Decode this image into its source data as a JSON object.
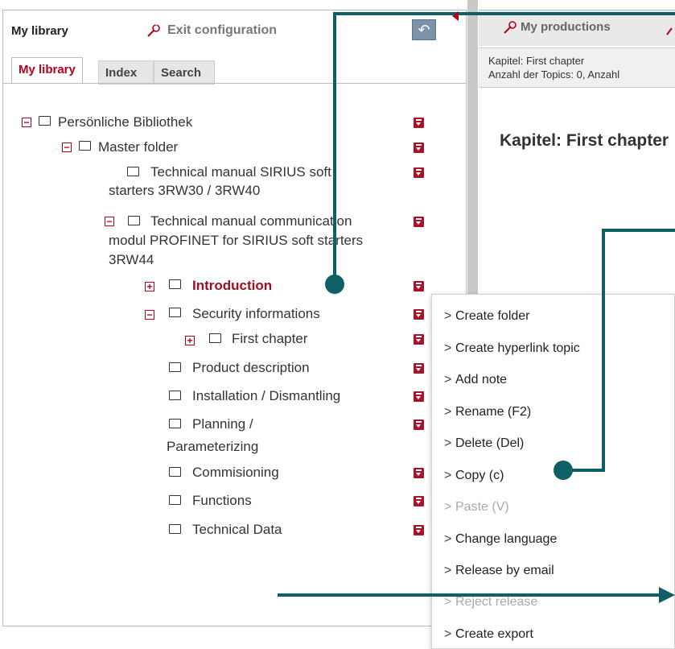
{
  "left_panel": {
    "title": "My library",
    "exit_config": "Exit configuration",
    "tabs": [
      {
        "label": "My library",
        "active": true
      },
      {
        "label": "Index",
        "active": false
      },
      {
        "label": "Search",
        "active": false
      }
    ],
    "tree": {
      "root": "Persönliche Bibliothek",
      "master": "Master folder",
      "manual1_line1": "Technical manual SIRIUS soft",
      "manual1_line2": "starters 3RW30 / 3RW40",
      "manual2_line1": "Technical manual communication",
      "manual2_line2": "modul PROFINET for SIRIUS soft starters",
      "manual2_line3": "3RW44",
      "introduction": "Introduction",
      "security": "Security informations",
      "first_chapter": "First chapter",
      "product_description": "Product description",
      "installation": "Installation / Dismantling",
      "planning_line1": "Planning /",
      "planning_line2": "Parameterizing",
      "commissioning": "Commisioning",
      "functions": "Functions",
      "technical_data": "Technical Data"
    }
  },
  "right_panel": {
    "tab_label": "My productions",
    "info_line1": "Kapitel: First chapter",
    "info_line2": "Anzahl der Topics: 0, Anzahl",
    "heading": "Kapitel: First chapter"
  },
  "context_menu": {
    "items": [
      {
        "label": "Create folder",
        "enabled": true
      },
      {
        "label": "Create hyperlink topic",
        "enabled": true
      },
      {
        "label": "Add note",
        "enabled": true
      },
      {
        "label": "Rename (F2)",
        "enabled": true
      },
      {
        "label": "Delete (Del)",
        "enabled": true
      },
      {
        "label": "Copy (c)",
        "enabled": true
      },
      {
        "label": "Paste (V)",
        "enabled": false
      },
      {
        "label": "Change language",
        "enabled": true
      },
      {
        "label": "Release by email",
        "enabled": true
      },
      {
        "label": "Reject release",
        "enabled": false
      },
      {
        "label": "Create export",
        "enabled": true
      }
    ],
    "chevron": ">"
  },
  "colors": {
    "accent_red": "#a5142a",
    "callout_teal": "#0f5f66"
  },
  "icons": [
    "wrench-icon",
    "undo-icon",
    "expand-icon",
    "collapse-icon",
    "folder-icon",
    "item-menu-icon",
    "chevron-right-icon"
  ]
}
